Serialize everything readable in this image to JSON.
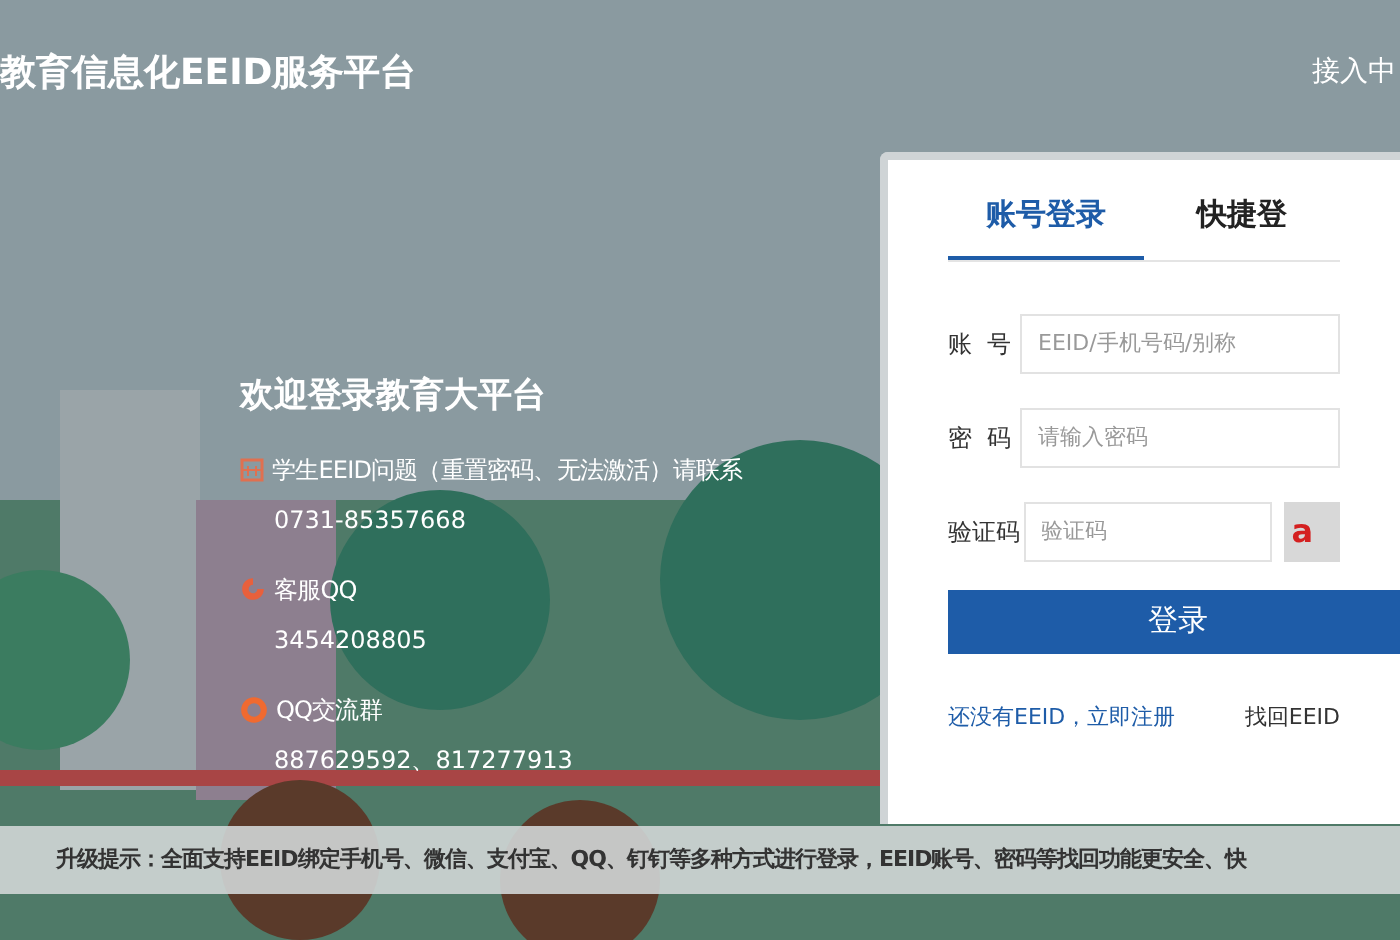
{
  "header": {
    "title": "教育信息化EEID服务平台",
    "link": "接入中"
  },
  "welcome": {
    "title": "欢迎登录教育大平台",
    "contacts": [
      {
        "kind": "phone",
        "label": "学生EEID问题（重置密码、无法激活）请联系",
        "value": "0731-85357668"
      },
      {
        "kind": "qq",
        "label": "客服QQ",
        "value": "3454208805"
      },
      {
        "kind": "group",
        "label": "QQ交流群",
        "value": "887629592、817277913"
      }
    ]
  },
  "login": {
    "tabs": [
      {
        "label": "账号登录",
        "selected": true
      },
      {
        "label": "快捷登",
        "selected": false
      }
    ],
    "fields": [
      {
        "label": "账  号",
        "placeholder": "EEID/手机号码/别称"
      },
      {
        "label": "密  码",
        "placeholder": "请输入密码"
      }
    ],
    "captcha": {
      "label": "验证码",
      "placeholder": "验证码",
      "image_text": "a"
    },
    "submit": "登录",
    "register_link": "还没有EEID，立即注册",
    "recover_link": "找回EEID"
  },
  "notice": "升级提示：全面支持EEID绑定手机号、微信、支付宝、QQ、钉钉等多种方式进行登录，EEID账号、密码等找回功能更安全、快"
}
